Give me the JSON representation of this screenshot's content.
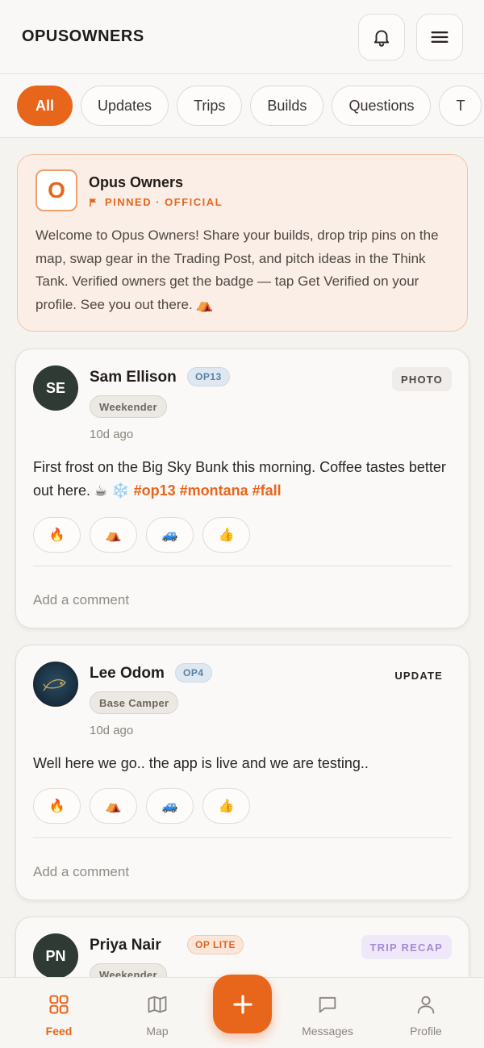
{
  "header": {
    "brand": "OPUSOWNERS"
  },
  "filters": [
    "All",
    "Updates",
    "Trips",
    "Builds",
    "Questions",
    "T"
  ],
  "pinned": {
    "logo_letter": "O",
    "name": "Opus Owners",
    "tag": "PINNED · OFFICIAL",
    "body": "Welcome to Opus Owners! Share your builds, drop trip pins on the map, swap gear in the Trading Post, and pitch ideas in the Think Tank. Verified owners get the badge — tap Get Verified on your profile. See you out there. ⛺"
  },
  "posts": [
    {
      "initials": "SE",
      "name": "Sam Ellison",
      "model": "OP13",
      "tier": "Weekender",
      "time": "10d ago",
      "type": "PHOTO",
      "text": "First frost on the Big Sky Bunk this morning. Coffee tastes better out here. ☕ ❄️ ",
      "hashtags": "#op13 #montana #fall",
      "reactions": [
        "🔥",
        "⛺",
        "🚙",
        "👍"
      ],
      "comment_placeholder": "Add a comment"
    },
    {
      "initials": "",
      "name": "Lee Odom",
      "model": "OP4",
      "tier": "Base Camper",
      "time": "10d ago",
      "type": "UPDATE",
      "text": "Well here we go.. the app is live and we are testing..",
      "reactions": [
        "🔥",
        "⛺",
        "🚙",
        "👍"
      ],
      "comment_placeholder": "Add a comment"
    },
    {
      "initials": "PN",
      "name": "Priya Nair",
      "model": "OP LITE",
      "tier": "Weekender",
      "type": "TRIP RECAP"
    }
  ],
  "nav": {
    "feed": "Feed",
    "map": "Map",
    "messages": "Messages",
    "profile": "Profile"
  },
  "colors": {
    "accent": "#e8651c"
  }
}
